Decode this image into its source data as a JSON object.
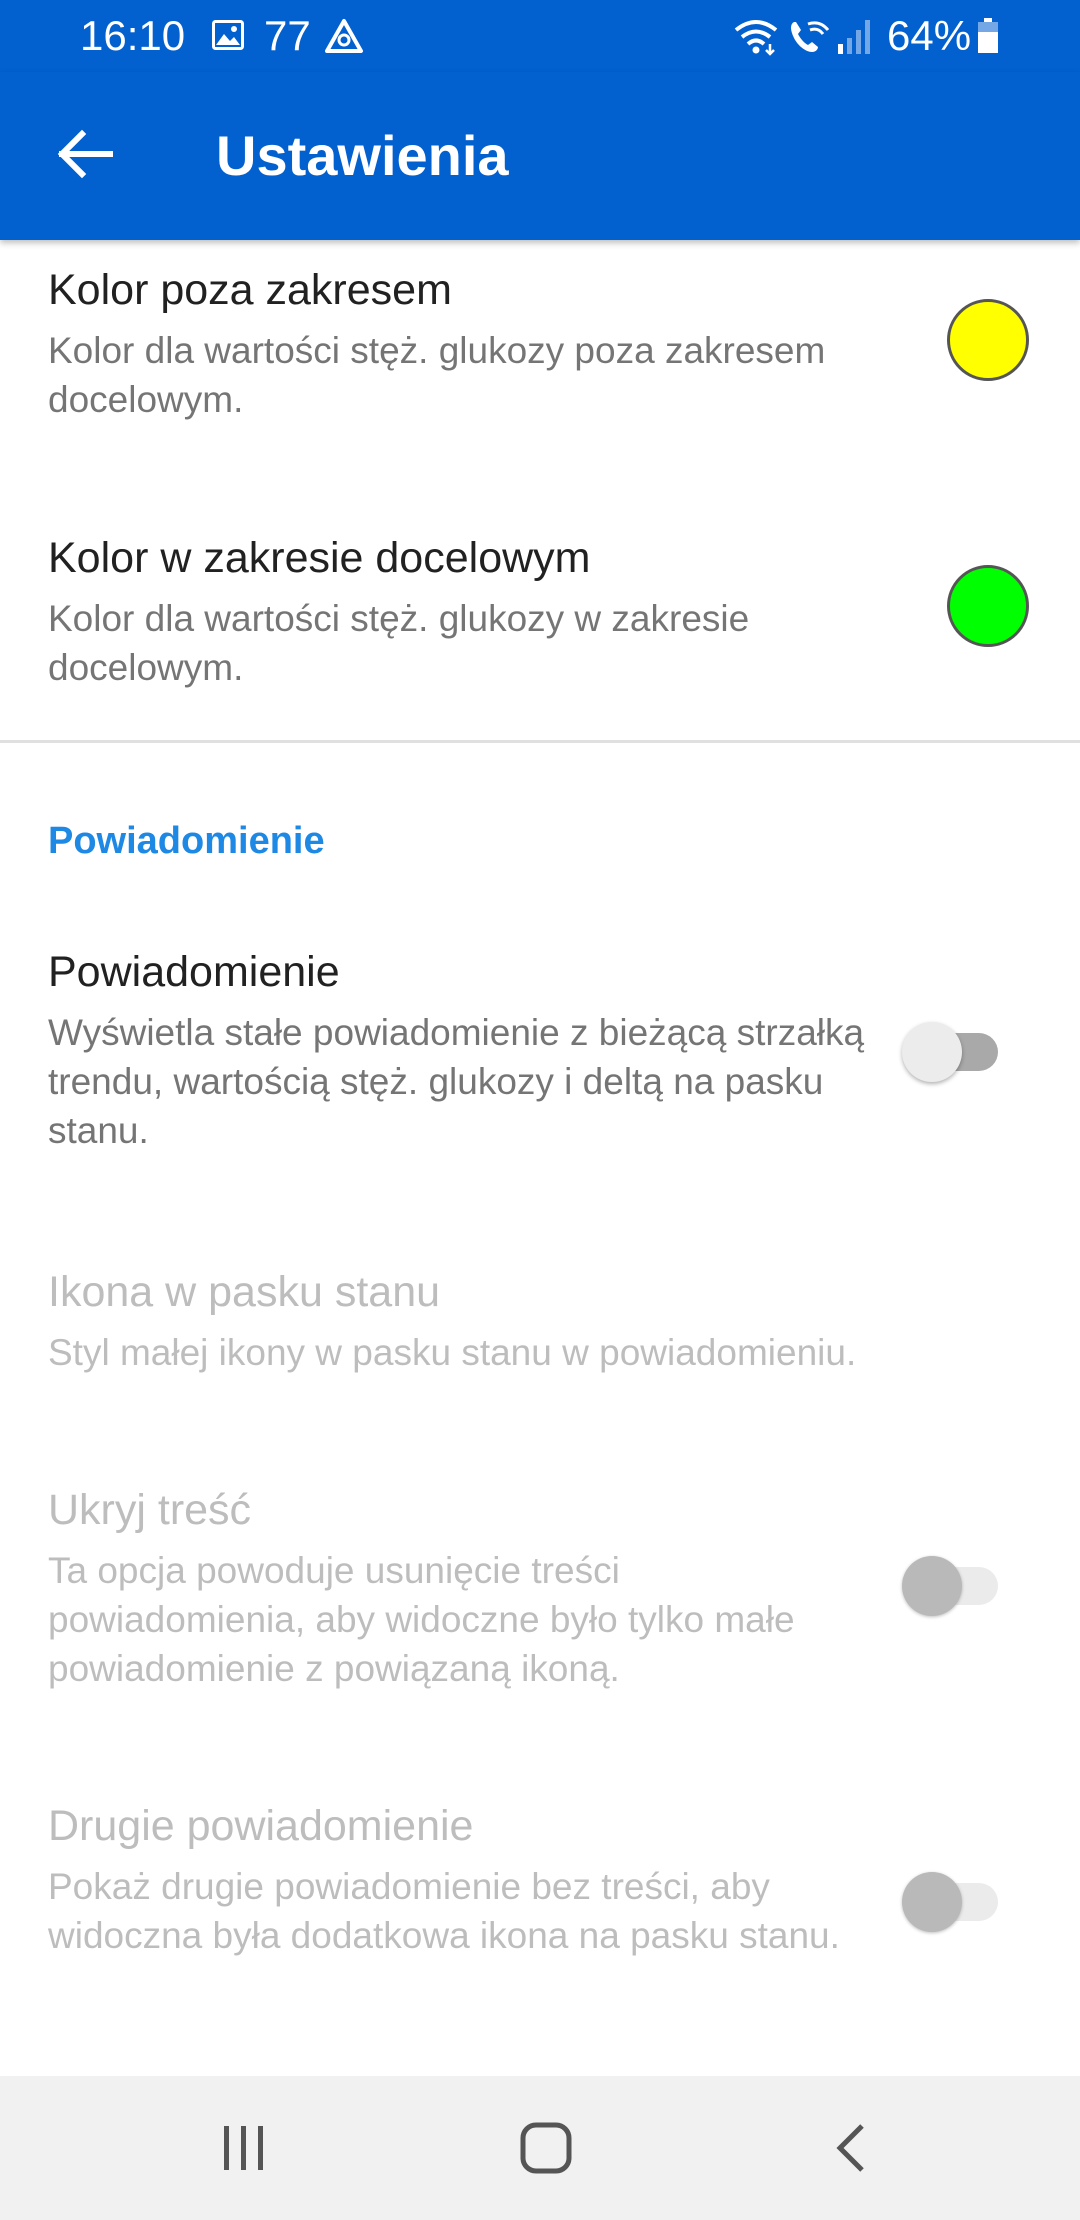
{
  "status_bar": {
    "time": "16:10",
    "notification_count": "77",
    "battery": "64%",
    "icons": [
      "image-icon",
      "alert-triangle-icon",
      "wifi-icon",
      "wifi-call-icon",
      "signal-icon",
      "battery-icon"
    ]
  },
  "app_bar": {
    "title": "Ustawienia",
    "back_icon": "arrow-left-icon"
  },
  "colors": {
    "primary": "#0360cf",
    "accent": "#1e88e5",
    "out_of_range_color": "#ffff00",
    "in_range_color": "#00ff00"
  },
  "prefs": {
    "out_of_range": {
      "title": "Kolor poza zakresem",
      "summary": "Kolor dla wartości stęż. glukozy poza zakresem docelowym."
    },
    "in_range": {
      "title": "Kolor w zakresie docelowym",
      "summary": "Kolor dla wartości stęż. glukozy w zakresie docelowym."
    },
    "category_notification": "Powiadomienie",
    "notification": {
      "title": "Powiadomienie",
      "summary": "Wyświetla stałe powiadomienie z bieżącą strzałką trendu, wartością stęż. glukozy i deltą na pasku stanu.",
      "enabled": false
    },
    "status_icon": {
      "title": "Ikona w pasku stanu",
      "summary": "Styl małej ikony w pasku stanu w powiadomieniu."
    },
    "hide_content": {
      "title": "Ukryj treść",
      "summary": "Ta opcja powoduje usunięcie treści powiadomienia, aby widoczne było tylko małe powiadomienie z powiązaną ikoną.",
      "enabled": false
    },
    "second_notification": {
      "title": "Drugie powiadomienie",
      "summary": "Pokaż drugie powiadomienie bez treści, aby widoczna była dodatkowa ikona na pasku stanu.",
      "enabled": false
    }
  },
  "nav_bar": {
    "icons": [
      "recent-apps-icon",
      "home-icon",
      "back-icon"
    ]
  }
}
